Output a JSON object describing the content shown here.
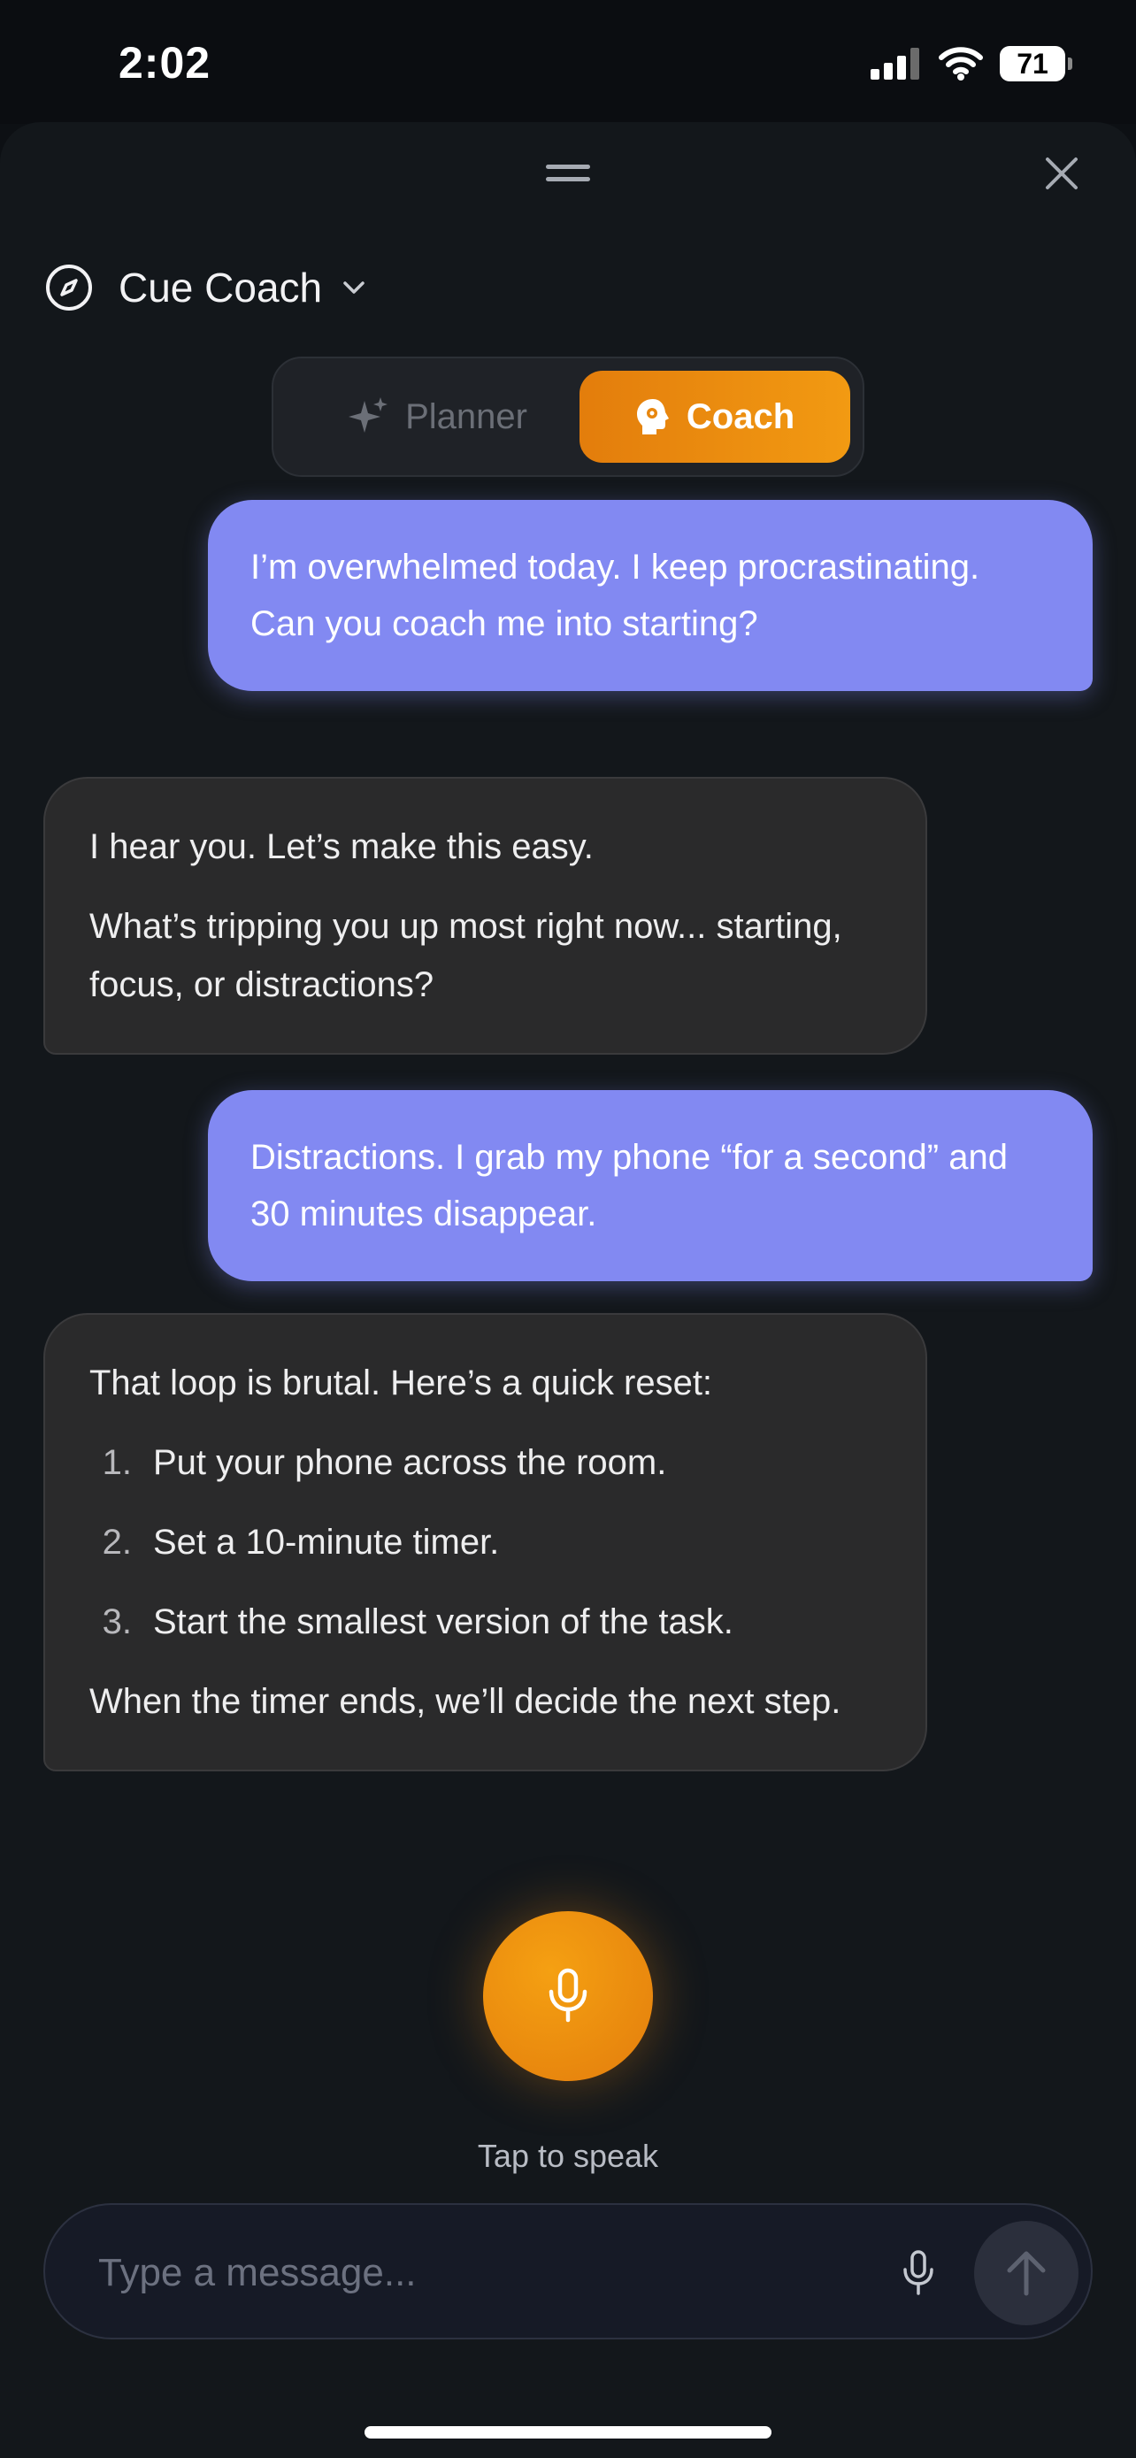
{
  "status_bar": {
    "time": "2:02",
    "battery": "71"
  },
  "header": {
    "title": "Cue Coach"
  },
  "mode_toggle": {
    "planner_label": "Planner",
    "coach_label": "Coach",
    "selected": "Coach"
  },
  "messages": [
    {
      "role": "user",
      "text": "I’m overwhelmed today. I keep procrastinating. Can you coach me into starting?"
    },
    {
      "role": "assistant",
      "paragraphs": [
        "I hear you. Let’s make this easy.",
        "What’s tripping you up most right now... starting, focus, or distractions?"
      ]
    },
    {
      "role": "user",
      "text": "Distractions. I grab my phone “for a second” and 30 minutes disappear."
    },
    {
      "role": "assistant",
      "intro": "That loop is brutal. Here’s a quick reset:",
      "steps": [
        {
          "num": "1.",
          "text": "Put your phone across the room."
        },
        {
          "num": "2.",
          "text": "Set a 10-minute timer."
        },
        {
          "num": "3.",
          "text": "Start the smallest version of the task."
        }
      ],
      "outro": "When the timer ends, we’ll decide the next step."
    }
  ],
  "voice": {
    "tap_label": "Tap to speak"
  },
  "composer": {
    "placeholder": "Type a message..."
  },
  "colors": {
    "accent": "#f29a12",
    "user_bubble": "#8289f2",
    "bot_bubble": "#2a2a2b",
    "background": "#13171b"
  }
}
